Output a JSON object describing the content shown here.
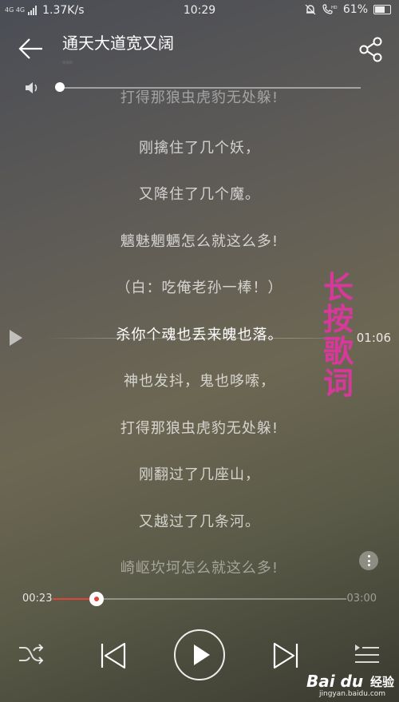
{
  "status_bar": {
    "network_type": "4G 4G",
    "speed": "1.37K/s",
    "time": "10:29",
    "battery": "61%"
  },
  "header": {
    "title": "通天大道宽又阔",
    "subtitle": "…"
  },
  "volume": {
    "level": 0.0
  },
  "lyrics": {
    "lines": [
      "打得那狼虫虎豹无处躲!",
      "刚擒住了几个妖，",
      "又降住了几个魔。",
      "魑魅魍魉怎么就这么多!",
      "（白：吃俺老孙一棒！）",
      "杀你个魂也丢来魄也落。",
      "神也发抖，鬼也哆嗦，",
      "打得那狼虫虎豹无处躲!",
      "刚翻过了几座山，",
      "又越过了几条河。",
      "崎岖坎坷怎么就这么多!"
    ],
    "current_index": 5,
    "marker_time": "01:06"
  },
  "annotation": {
    "text_lines": [
      "长",
      "按",
      "歌",
      "词"
    ]
  },
  "progress": {
    "elapsed": "00:23",
    "total": "03:00",
    "fraction": 0.15
  },
  "watermark": {
    "brand": "Bai du",
    "product": "经验",
    "url": "jingyan.baidu.com"
  },
  "colors": {
    "accent": "#e0453a",
    "annotation": "#d6399a"
  }
}
